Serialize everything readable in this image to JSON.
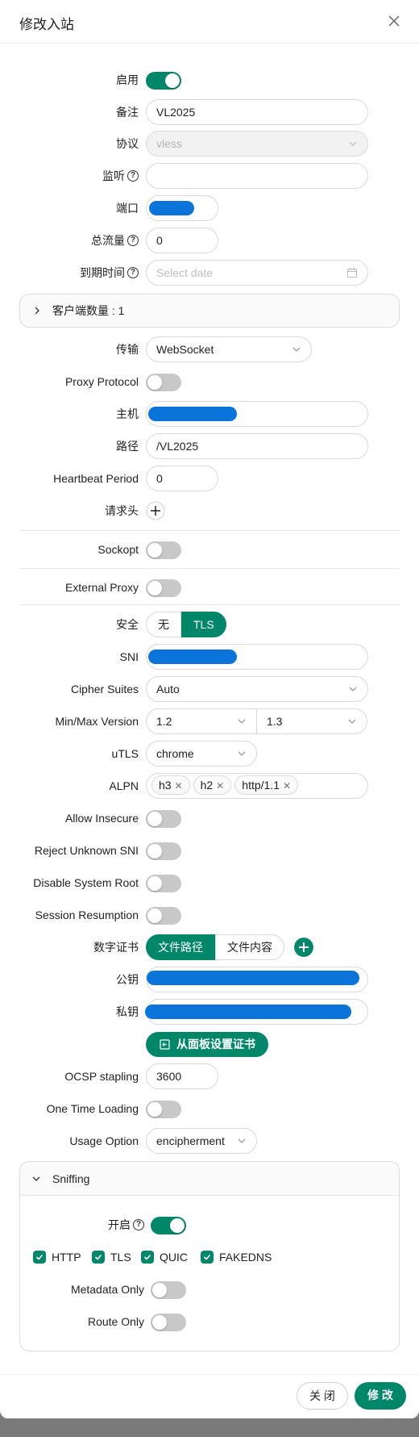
{
  "modal": {
    "title": "修改入站"
  },
  "fields": {
    "enable": {
      "label": "启用",
      "on": true
    },
    "remark": {
      "label": "备注",
      "value": "VL2025"
    },
    "protocol": {
      "label": "协议",
      "value": "vless"
    },
    "listen": {
      "label": "监听",
      "value": ""
    },
    "port": {
      "label": "端口"
    },
    "total_traffic": {
      "label": "总流量",
      "value": "0"
    },
    "expiry": {
      "label": "到期时间",
      "placeholder": "Select date"
    }
  },
  "clients_panel": {
    "label": "客户端数量 : 1"
  },
  "transport": {
    "network": {
      "label": "传输",
      "value": "WebSocket"
    },
    "proxy_protocol": {
      "label": "Proxy Protocol",
      "on": false
    },
    "host": {
      "label": "主机"
    },
    "path": {
      "label": "路径",
      "value": "/VL2025"
    },
    "heartbeat": {
      "label": "Heartbeat Period",
      "value": "0"
    },
    "headers": {
      "label": "请求头"
    }
  },
  "sockopt": {
    "label": "Sockopt",
    "on": false
  },
  "external_proxy": {
    "label": "External Proxy",
    "on": false
  },
  "security": {
    "label": "安全",
    "options": [
      "无",
      "TLS"
    ],
    "selected": "TLS",
    "sni": {
      "label": "SNI"
    },
    "cipher_suites": {
      "label": "Cipher Suites",
      "value": "Auto"
    },
    "minmax": {
      "label": "Min/Max Version",
      "min": "1.2",
      "max": "1.3"
    },
    "utls": {
      "label": "uTLS",
      "value": "chrome"
    },
    "alpn": {
      "label": "ALPN",
      "tags": [
        "h3",
        "h2",
        "http/1.1"
      ]
    },
    "allow_insecure": {
      "label": "Allow Insecure",
      "on": false
    },
    "reject_unknown_sni": {
      "label": "Reject Unknown SNI",
      "on": false
    },
    "disable_system_root": {
      "label": "Disable System Root",
      "on": false
    },
    "session_resumption": {
      "label": "Session Resumption",
      "on": false
    },
    "certificate": {
      "label": "数字证书",
      "options": [
        "文件路径",
        "文件内容"
      ],
      "selected": "文件路径"
    },
    "public_key": {
      "label": "公钥"
    },
    "private_key": {
      "label": "私钥"
    },
    "set_from_panel_btn": "从面板设置证书",
    "ocsp": {
      "label": "OCSP stapling",
      "value": "3600"
    },
    "one_time_loading": {
      "label": "One Time Loading",
      "on": false
    },
    "usage_option": {
      "label": "Usage Option",
      "value": "encipherment"
    }
  },
  "sniffing": {
    "title": "Sniffing",
    "enable": {
      "label": "开启",
      "on": true
    },
    "dest": [
      "HTTP",
      "TLS",
      "QUIC",
      "FAKEDNS"
    ],
    "metadata_only": {
      "label": "Metadata Only",
      "on": false
    },
    "route_only": {
      "label": "Route Only",
      "on": false
    }
  },
  "footer": {
    "close_label": "关 闭",
    "submit_label": "修 改"
  },
  "colors": {
    "accent": "#00876a",
    "redaction": "#0a74da",
    "backdrop": "#7a7a7a"
  }
}
